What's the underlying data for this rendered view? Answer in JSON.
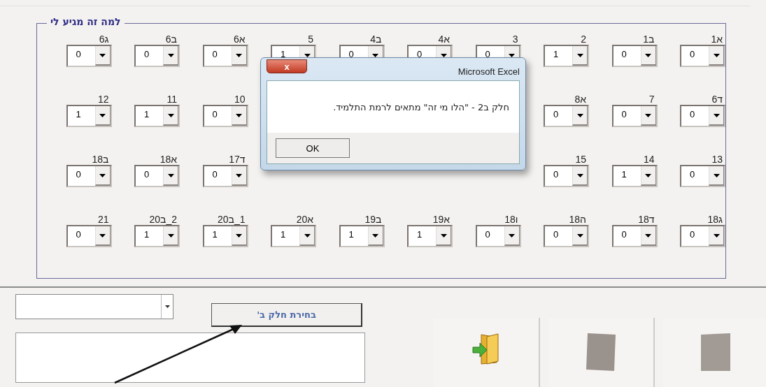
{
  "frame": {
    "title": "למה זה מגיע לי",
    "rows": [
      [
        {
          "label": "1א",
          "value": "0"
        },
        {
          "label": "1ב",
          "value": "0"
        },
        {
          "label": "2",
          "value": "1"
        },
        {
          "label": "3",
          "value": "0"
        },
        {
          "label": "4א",
          "value": "0"
        },
        {
          "label": "4ב",
          "value": "0"
        },
        {
          "label": "5",
          "value": "1"
        },
        {
          "label": "6א",
          "value": "0"
        },
        {
          "label": "6ב",
          "value": "0"
        },
        {
          "label": "6ג",
          "value": "0"
        }
      ],
      [
        {
          "label": "6ד",
          "value": "0"
        },
        {
          "label": "7",
          "value": "0"
        },
        {
          "label": "8א",
          "value": "0"
        },
        null,
        null,
        null,
        null,
        {
          "label": "10",
          "value": "0"
        },
        {
          "label": "11",
          "value": "1"
        },
        {
          "label": "12",
          "value": "1"
        }
      ],
      [
        {
          "label": "13",
          "value": "0"
        },
        {
          "label": "14",
          "value": "1"
        },
        {
          "label": "15",
          "value": "0"
        },
        null,
        null,
        null,
        null,
        {
          "label": "17ד",
          "value": "0"
        },
        {
          "label": "18א",
          "value": "0"
        },
        {
          "label": "18ב",
          "value": "0"
        }
      ],
      [
        {
          "label": "18ג",
          "value": "0"
        },
        {
          "label": "18ד",
          "value": "0"
        },
        {
          "label": "18ה",
          "value": "0"
        },
        {
          "label": "18ו",
          "value": "0"
        },
        {
          "label": "19א",
          "value": "1"
        },
        {
          "label": "19ב",
          "value": "1"
        },
        {
          "label": "20א",
          "value": "1"
        },
        {
          "label": "20ב_1",
          "value": "1"
        },
        {
          "label": "20ב_2",
          "value": "1"
        },
        {
          "label": "21",
          "value": "0"
        }
      ]
    ]
  },
  "dialog": {
    "title": "Microsoft Excel",
    "close": "x",
    "message": "חלק ב2 - \"הלו מי זה\" מתאים לרמת התלמיד.",
    "button": "OK"
  },
  "bottom": {
    "select_part_button": "בחירת חלק ב'"
  }
}
